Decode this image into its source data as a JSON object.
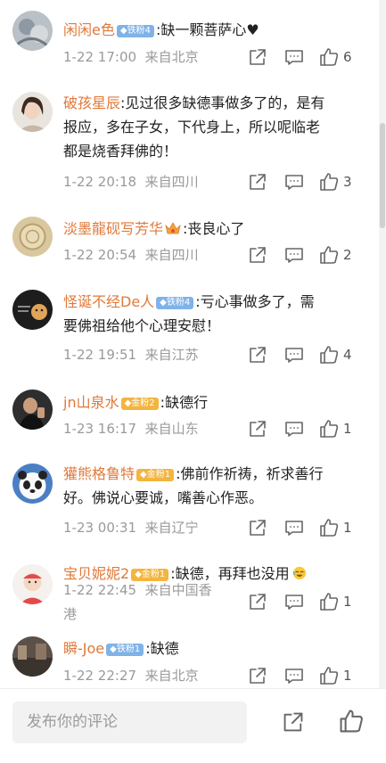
{
  "comments": [
    {
      "username": "闲闲e色",
      "badge": {
        "type": "iron",
        "label": "铁粉4"
      },
      "text": ":缺一颗菩萨心♥",
      "date": "1-22 17:00",
      "location": "来自北京",
      "likes": "6"
    },
    {
      "username": "破孩星辰",
      "text_line1": ":见过很多缺德事做多了的，是有",
      "text_line2": "报应，多在子女，下代身上，所以呢临老",
      "text_line3": "都是烧香拜佛的！",
      "date": "1-22 20:18",
      "location": "来自四川",
      "likes": "3"
    },
    {
      "username": "淡墨龍砚写芳华",
      "text": ":丧良心了",
      "date": "1-22 20:54",
      "location": "来自四川",
      "likes": "2"
    },
    {
      "username": "怪诞不经De人",
      "badge": {
        "type": "iron",
        "label": "铁粉4"
      },
      "text_line1": ":亏心事做多了，需",
      "text_line2": "要佛祖给他个心理安慰！",
      "date": "1-22 19:51",
      "location": "来自江苏",
      "likes": "4"
    },
    {
      "username": "jn山泉水",
      "badge": {
        "type": "gold",
        "label": "金粉2"
      },
      "text": ":缺德行",
      "date": "1-23 16:17",
      "location": "来自山东",
      "likes": "1"
    },
    {
      "username": "獾熊格鲁特",
      "badge": {
        "type": "gold",
        "label": "金粉1"
      },
      "text_line1": ":佛前作祈祷，祈求善行",
      "text_line2": "好。佛说心要诚，嘴善心作恶。",
      "date": "1-23 00:31",
      "location": "来自辽宁",
      "likes": "1"
    },
    {
      "username": "宝贝妮妮2",
      "badge": {
        "type": "gold",
        "label": "金粉1"
      },
      "text": ":缺德，再拜也没用",
      "date": "1-22 22:45",
      "location_line1": "来自中国香",
      "location_line2": "港",
      "likes": "1"
    },
    {
      "username": "瞬-Joe",
      "badge": {
        "type": "iron",
        "label": "铁粉1"
      },
      "text": ":缺德",
      "date": "1-22 22:27",
      "location": "来自北京",
      "likes": "1"
    }
  ],
  "composer": {
    "placeholder": "发布你的评论"
  },
  "icons": {
    "share": "share-icon",
    "reply": "comment-icon",
    "like": "thumbs-up-icon"
  },
  "colors": {
    "username": "#e0793a",
    "meta": "#9a9a9a",
    "iron_badge": "#7fb3e8",
    "gold_badge": "#f3b53f"
  }
}
